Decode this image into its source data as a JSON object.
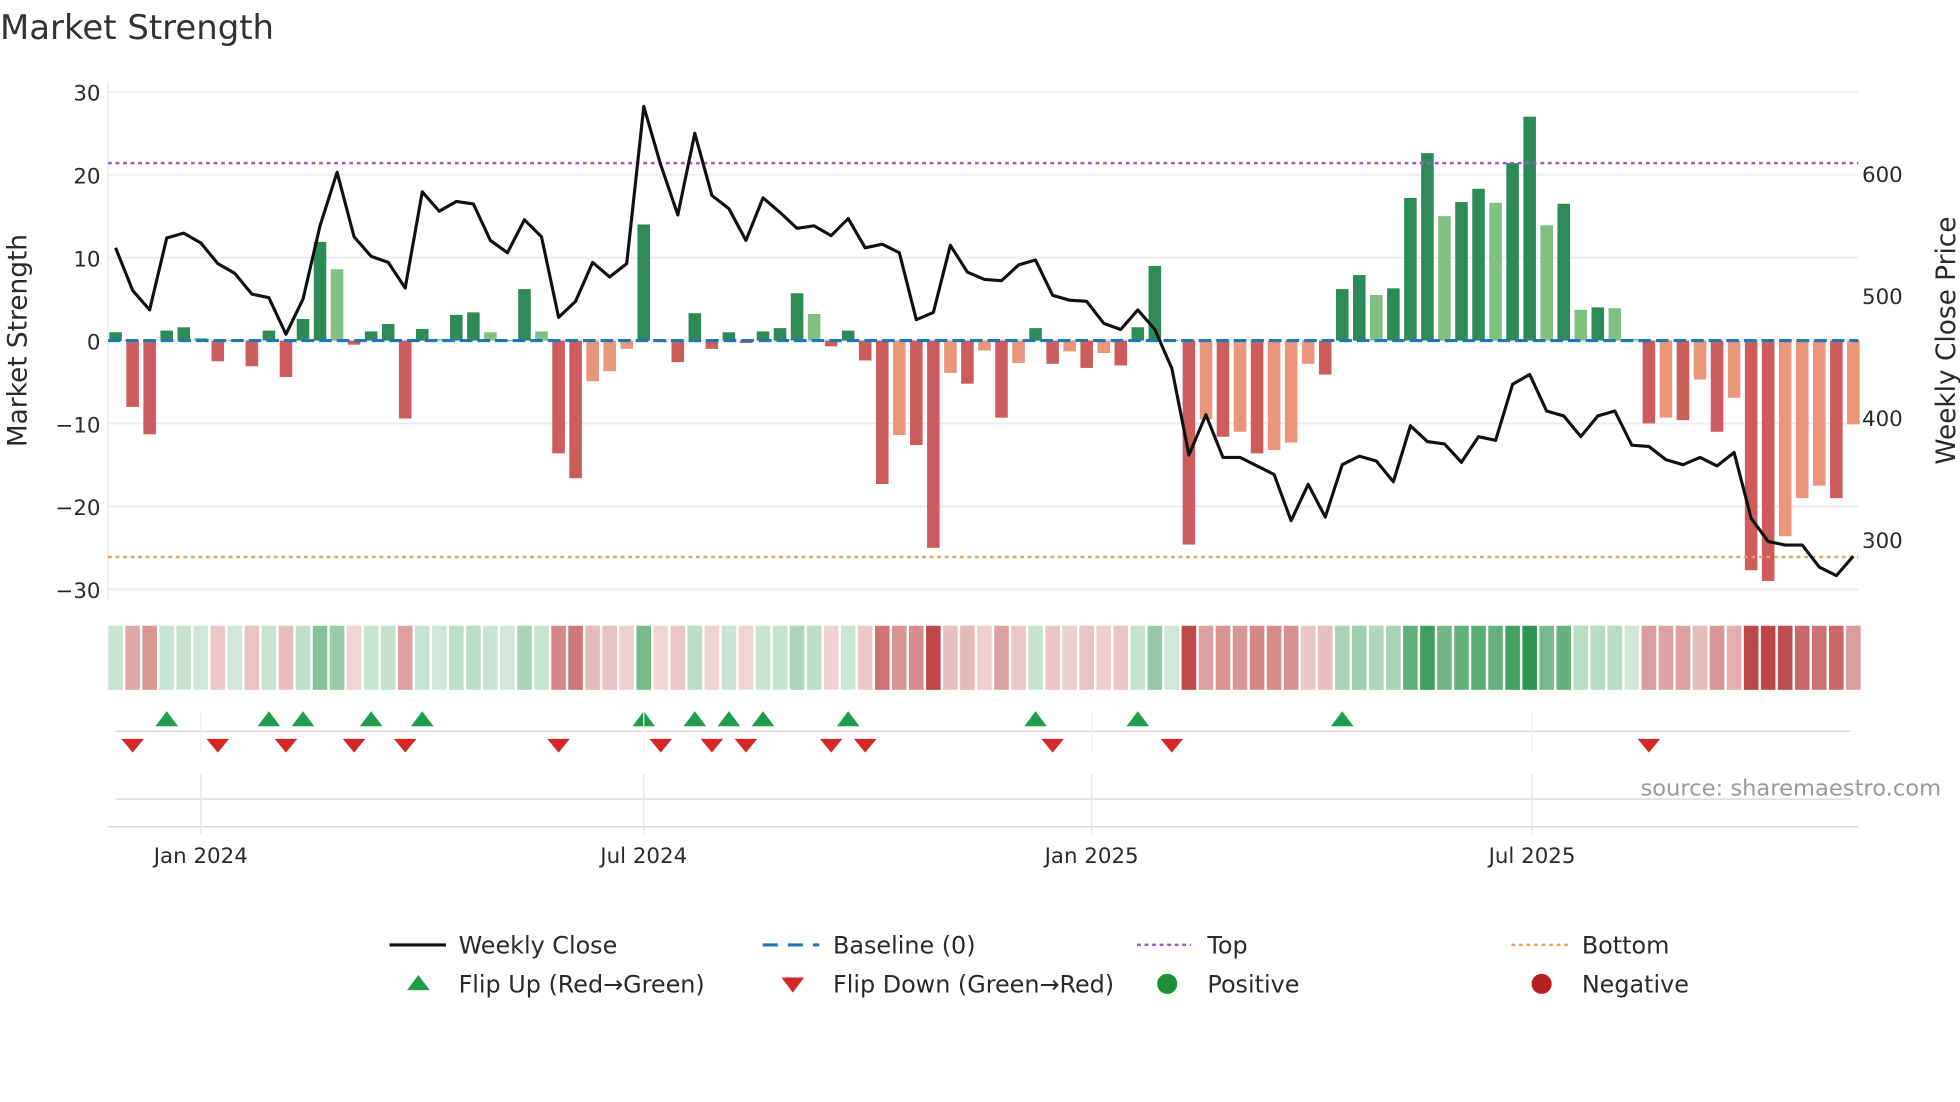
{
  "title": "Market Strength",
  "source": "source: sharemaestro.com",
  "legend": {
    "weekly_close": "Weekly Close",
    "baseline": "Baseline (0)",
    "top": "Top",
    "bottom": "Bottom",
    "flip_up": "Flip Up (Red→Green)",
    "flip_down": "Flip Down (Green→Red)",
    "positive": "Positive",
    "negative": "Negative"
  },
  "colors": {
    "strong_positive": "#2e8b57",
    "weak_positive": "#80c080",
    "strong_negative": "#cd5c5c",
    "weak_negative": "#e9967a",
    "line": "#111111",
    "baseline": "#1f77b4",
    "top": "#9b59d6",
    "bottom": "#f0a060",
    "flip_up": "#1e9e4a",
    "flip_down": "#d62728",
    "positive_dot": "#1e8f3a",
    "negative_dot": "#b22222"
  },
  "chart_data": {
    "type": "bar",
    "title": "Market Strength",
    "xlabel": "",
    "ylabel": "Market Strength",
    "y2label": "Weekly Close Price",
    "ylim": [
      -32,
      31
    ],
    "y2lim": [
      254,
      703
    ],
    "yticks": [
      30,
      20,
      10,
      0,
      -10,
      -20,
      -30
    ],
    "yticklabels": [
      "30",
      "20",
      "10",
      "0",
      "−10",
      "−20",
      "−30"
    ],
    "y2ticks": [
      600,
      500,
      400,
      300
    ],
    "y2ticklabels": [
      "600",
      "500",
      "400",
      "300"
    ],
    "frequency": "weekly",
    "xticks": [
      {
        "week_index": 5,
        "label": "Jan 2024"
      },
      {
        "week_index": 31,
        "label": "Jul 2024"
      },
      {
        "week_index": 57.29,
        "label": "Jan 2025"
      },
      {
        "week_index": 83.14,
        "label": "Jul 2025"
      }
    ],
    "top_level": 21.4,
    "bottom_level": -26.1,
    "baseline": 0,
    "strength": [
      1,
      -8,
      -11.3,
      1.2,
      1.6,
      0.3,
      -2.5,
      0,
      -3.1,
      1.2,
      -4.4,
      2.6,
      11.9,
      8.6,
      -0.5,
      1.1,
      2.0,
      -9.4,
      1.4,
      0.2,
      3.1,
      3.4,
      1.0,
      0,
      6.2,
      1.1,
      -13.6,
      -16.6,
      -4.9,
      -3.7,
      -1.0,
      14.0,
      -0.2,
      -2.6,
      3.3,
      -1.0,
      1.0,
      -0.3,
      1.1,
      1.5,
      5.7,
      3.2,
      -0.7,
      1.2,
      -2.4,
      -17.3,
      -11.4,
      -12.6,
      -25,
      -3.9,
      -5.2,
      -1.2,
      -9.3,
      -2.7,
      1.5,
      -2.8,
      -1.3,
      -3.3,
      -1.5,
      -3.0,
      1.6,
      9.0,
      0,
      -24.6,
      -9.5,
      -11.6,
      -11.0,
      -13.6,
      -13.2,
      -12.3,
      -2.8,
      -4.1,
      6.2,
      7.9,
      5.5,
      6.3,
      17.2,
      22.6,
      15.0,
      16.7,
      18.3,
      16.6,
      21.4,
      27.0,
      13.9,
      16.5,
      3.7,
      4.0,
      3.9,
      0.2,
      -10.0,
      -9.3,
      -9.6,
      -4.7,
      -11.0,
      -6.9,
      -27.7,
      -29.0,
      -23.6,
      -19.0,
      -17.5,
      -19.0,
      -10.1
    ],
    "weak_weeks": [
      6,
      14,
      20,
      23,
      26,
      29,
      30,
      31,
      42,
      47,
      50,
      52,
      54,
      57,
      59,
      65,
      67,
      69,
      70,
      71,
      75,
      79,
      82,
      85,
      87,
      89,
      90,
      92,
      94,
      96,
      99,
      100,
      101,
      103
    ],
    "weekly_close": [
      539,
      504,
      488,
      547,
      551,
      543,
      526,
      518,
      501,
      498,
      468,
      497,
      557,
      601,
      548,
      532,
      527,
      506,
      585,
      569,
      577,
      575,
      545,
      535,
      562,
      548,
      482,
      495,
      527,
      515,
      526,
      655,
      607,
      566,
      633,
      582,
      571,
      545,
      580,
      568,
      555,
      557,
      549,
      563,
      539,
      542,
      535,
      480,
      486,
      541,
      519,
      513,
      512,
      525,
      529,
      500,
      496,
      495,
      477,
      472,
      488,
      472,
      440,
      369,
      402,
      367,
      367,
      360,
      353,
      315,
      345,
      318,
      361,
      368,
      364,
      347,
      393,
      380,
      378,
      363,
      384,
      381,
      427,
      435,
      405,
      401,
      384,
      401,
      405,
      377,
      376,
      365,
      361,
      367,
      360,
      371,
      317,
      298,
      295,
      295,
      277,
      270,
      286
    ],
    "flip_up_weeks": [
      4,
      10,
      12,
      16,
      19,
      32,
      35,
      37,
      39,
      44,
      55,
      61,
      73
    ],
    "flip_down_weeks": [
      2,
      7,
      11,
      15,
      18,
      27,
      33,
      36,
      38,
      43,
      45,
      56,
      63,
      91
    ],
    "legend_position": "bottom"
  }
}
